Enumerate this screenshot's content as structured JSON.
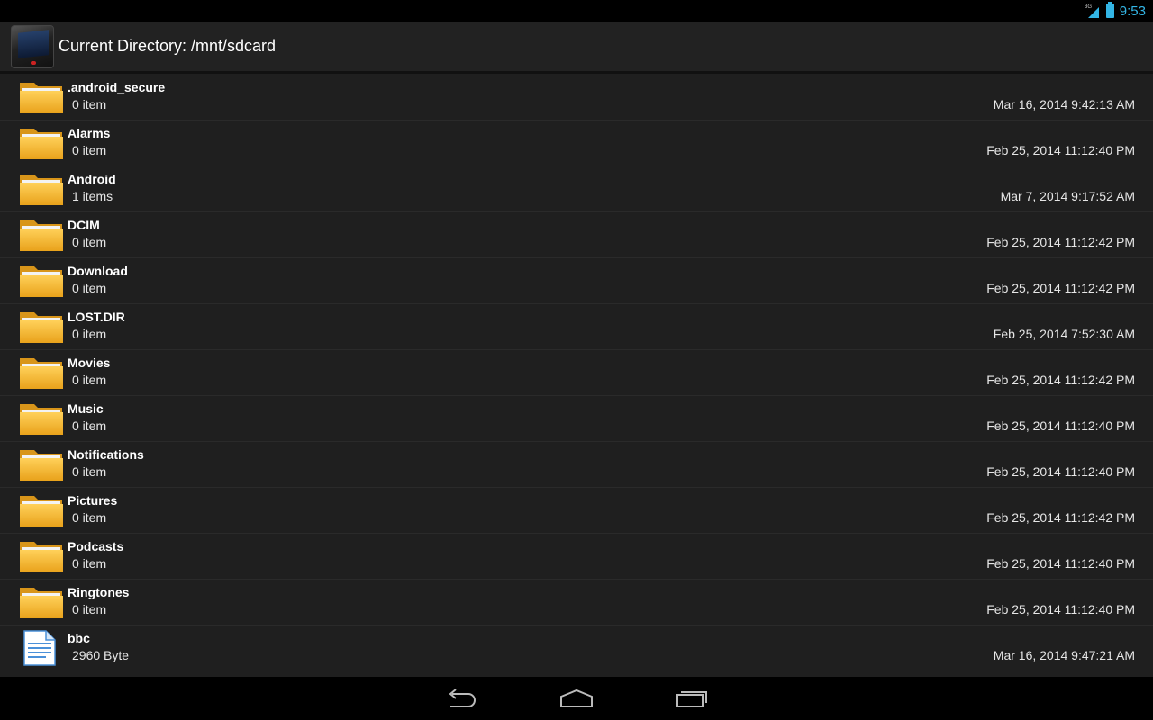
{
  "status": {
    "time": "9:53",
    "network": "3G"
  },
  "header": {
    "title": "Current Directory: /mnt/sdcard"
  },
  "files": [
    {
      "name": ".android_secure",
      "count": "0 item",
      "date": "Mar 16, 2014 9:42:13 AM",
      "type": "folder"
    },
    {
      "name": "Alarms",
      "count": "0 item",
      "date": "Feb 25, 2014 11:12:40 PM",
      "type": "folder"
    },
    {
      "name": "Android",
      "count": "1 items",
      "date": "Mar 7, 2014 9:17:52 AM",
      "type": "folder"
    },
    {
      "name": "DCIM",
      "count": "0 item",
      "date": "Feb 25, 2014 11:12:42 PM",
      "type": "folder"
    },
    {
      "name": "Download",
      "count": "0 item",
      "date": "Feb 25, 2014 11:12:42 PM",
      "type": "folder"
    },
    {
      "name": "LOST.DIR",
      "count": "0 item",
      "date": "Feb 25, 2014 7:52:30 AM",
      "type": "folder"
    },
    {
      "name": "Movies",
      "count": "0 item",
      "date": "Feb 25, 2014 11:12:42 PM",
      "type": "folder"
    },
    {
      "name": "Music",
      "count": "0 item",
      "date": "Feb 25, 2014 11:12:40 PM",
      "type": "folder"
    },
    {
      "name": "Notifications",
      "count": "0 item",
      "date": "Feb 25, 2014 11:12:40 PM",
      "type": "folder"
    },
    {
      "name": "Pictures",
      "count": "0 item",
      "date": "Feb 25, 2014 11:12:42 PM",
      "type": "folder"
    },
    {
      "name": "Podcasts",
      "count": "0 item",
      "date": "Feb 25, 2014 11:12:40 PM",
      "type": "folder"
    },
    {
      "name": "Ringtones",
      "count": "0 item",
      "date": "Feb 25, 2014 11:12:40 PM",
      "type": "folder"
    },
    {
      "name": "bbc",
      "count": "2960 Byte",
      "date": "Mar 16, 2014 9:47:21 AM",
      "type": "file"
    }
  ],
  "icons": {
    "folder": "folder-icon",
    "file": "document-icon",
    "back": "back-icon",
    "home": "home-icon",
    "recents": "recent-apps-icon"
  },
  "colors": {
    "accent": "#33b5e5",
    "folder": "#f5b731",
    "document": "#4a90d9"
  }
}
